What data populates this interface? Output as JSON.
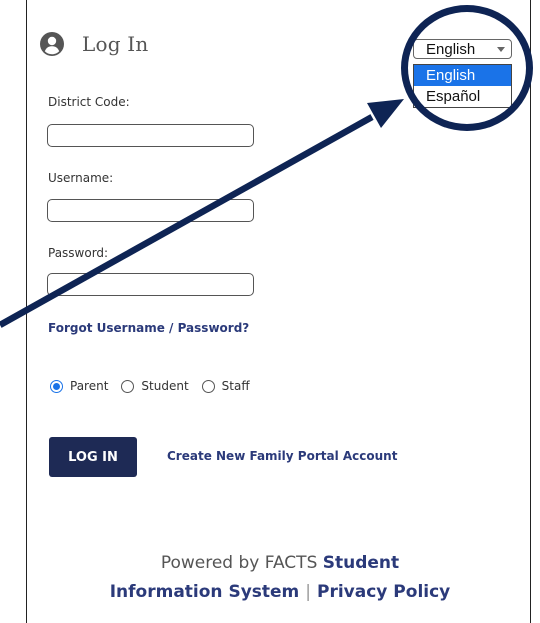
{
  "login": {
    "title": "Log In",
    "icon": "user-circle-icon",
    "fields": {
      "district_code_label": "District Code:",
      "username_label": "Username:",
      "password_label": "Password:"
    },
    "forgot_link": "Forgot Username / Password?",
    "roles": {
      "parent": "Parent",
      "student": "Student",
      "staff": "Staff",
      "selected": "Parent"
    },
    "login_button": "LOG IN",
    "create_account_link": "Create New Family Portal Account"
  },
  "language": {
    "selected": "English",
    "options": [
      "English",
      "Español"
    ]
  },
  "footer": {
    "powered_by": "Powered by FACTS ",
    "sis_part1": "Student",
    "sis_part2": "Information System",
    "separator": "|",
    "privacy": "Privacy Policy"
  },
  "colors": {
    "annotation": "#0e2454",
    "button_bg": "#1e2a55",
    "link": "#2b3a7a",
    "selected_option": "#1a73e8"
  }
}
